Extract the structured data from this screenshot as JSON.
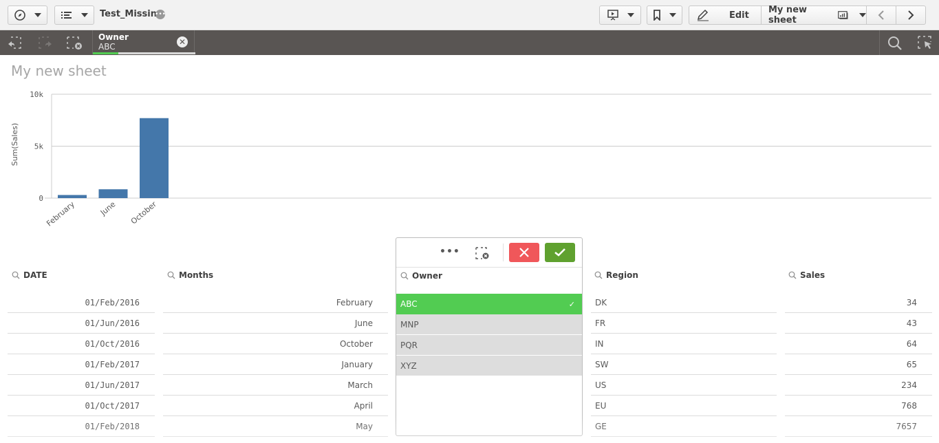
{
  "toolbar": {
    "app_title": "Test_Missing",
    "edit_label": "Edit",
    "sheet_selector_label": "My new sheet"
  },
  "selections": {
    "field": "Owner",
    "value": "ABC",
    "selected_fraction": 0.25
  },
  "sheet": {
    "title": "My new sheet"
  },
  "chart_data": {
    "type": "bar",
    "title": "",
    "xlabel": "",
    "ylabel": "Sum(Sales)",
    "categories": [
      "February",
      "June",
      "October"
    ],
    "values": [
      300,
      850,
      7700
    ],
    "ylim": [
      0,
      10000
    ],
    "yticks": [
      0,
      5000,
      10000
    ],
    "ytick_labels": [
      "0",
      "5k",
      "10k"
    ],
    "grid": true,
    "bar_color": "#4477aa"
  },
  "listboxes": {
    "date": {
      "label": "DATE",
      "items": [
        {
          "value": "01/Feb/2016",
          "state": "optional"
        },
        {
          "value": "01/Jun/2016",
          "state": "optional"
        },
        {
          "value": "01/Oct/2016",
          "state": "optional"
        },
        {
          "value": "01/Feb/2017",
          "state": "optional"
        },
        {
          "value": "01/Jun/2017",
          "state": "optional"
        },
        {
          "value": "01/Oct/2017",
          "state": "optional"
        },
        {
          "value": "01/Feb/2018",
          "state": "optional"
        }
      ]
    },
    "months": {
      "label": "Months",
      "items": [
        {
          "value": "February",
          "state": "optional"
        },
        {
          "value": "June",
          "state": "optional"
        },
        {
          "value": "October",
          "state": "optional"
        },
        {
          "value": "January",
          "state": "alternative"
        },
        {
          "value": "March",
          "state": "alternative"
        },
        {
          "value": "April",
          "state": "alternative"
        },
        {
          "value": "May",
          "state": "alternative"
        }
      ]
    },
    "owner": {
      "label": "Owner",
      "items": [
        {
          "value": "ABC",
          "state": "selected"
        },
        {
          "value": "MNP",
          "state": "possible"
        },
        {
          "value": "PQR",
          "state": "possible"
        },
        {
          "value": "XYZ",
          "state": "possible"
        }
      ]
    },
    "region": {
      "label": "Region",
      "items": [
        {
          "value": "DK",
          "state": "optional"
        },
        {
          "value": "FR",
          "state": "optional"
        },
        {
          "value": "IN",
          "state": "optional"
        },
        {
          "value": "SW",
          "state": "optional"
        },
        {
          "value": "US",
          "state": "optional"
        },
        {
          "value": "EU",
          "state": "alternative"
        },
        {
          "value": "GE",
          "state": "alternative"
        }
      ]
    },
    "sales": {
      "label": "Sales",
      "items": [
        {
          "value": "34",
          "state": "optional"
        },
        {
          "value": "43",
          "state": "optional"
        },
        {
          "value": "64",
          "state": "optional"
        },
        {
          "value": "65",
          "state": "optional"
        },
        {
          "value": "234",
          "state": "optional"
        },
        {
          "value": "768",
          "state": "optional"
        },
        {
          "value": "7657",
          "state": "optional"
        }
      ]
    }
  },
  "colors": {
    "selected": "#52cc52",
    "possible": "#dddddd",
    "alternative": "#a9a9a9",
    "cancel": "#f0575a",
    "confirm": "#5fa12f",
    "selection_bar": "#595553"
  }
}
